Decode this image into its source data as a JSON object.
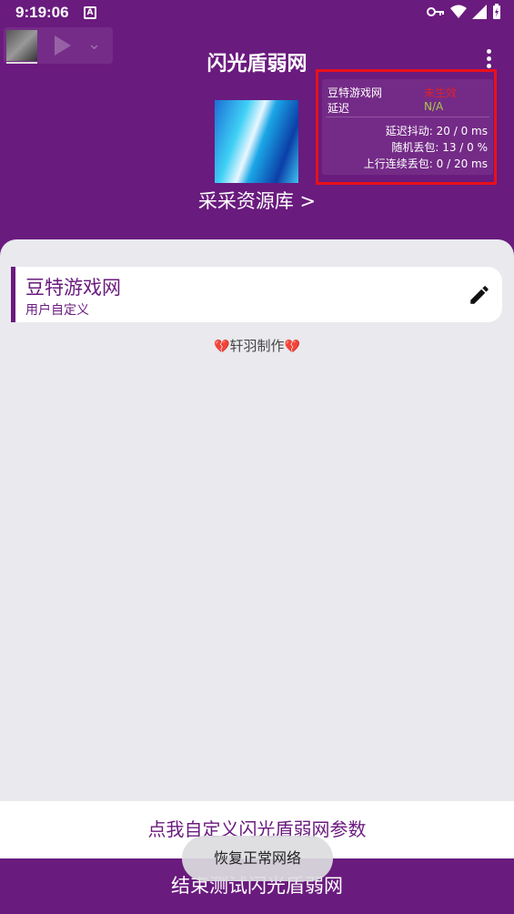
{
  "status": {
    "time": "9:19:06",
    "a_badge": "A"
  },
  "header": {
    "title": "闪光盾弱网"
  },
  "resource": {
    "label": "采采资源库 >"
  },
  "overlay": {
    "game": "豆特游戏网",
    "game_state": "未生效",
    "latency_label": "延迟",
    "latency_value": "N/A",
    "jitter": "延迟抖动: 20 / 0 ms",
    "loss": "随机丢包: 13 / 0 %",
    "burst": "上行连续丢包: 0 / 20 ms"
  },
  "card": {
    "name": "豆特游戏网",
    "subtitle": "用户自定义"
  },
  "credit": "轩羽制作",
  "buttons": {
    "customize": "点我自定义闪光盾弱网参数",
    "end_test": "结束测试闪光盾弱网"
  },
  "toast": "恢复正常网络",
  "colors": {
    "primary": "#6a1b7e",
    "warning": "#e0202a",
    "na": "#a6c94a"
  }
}
